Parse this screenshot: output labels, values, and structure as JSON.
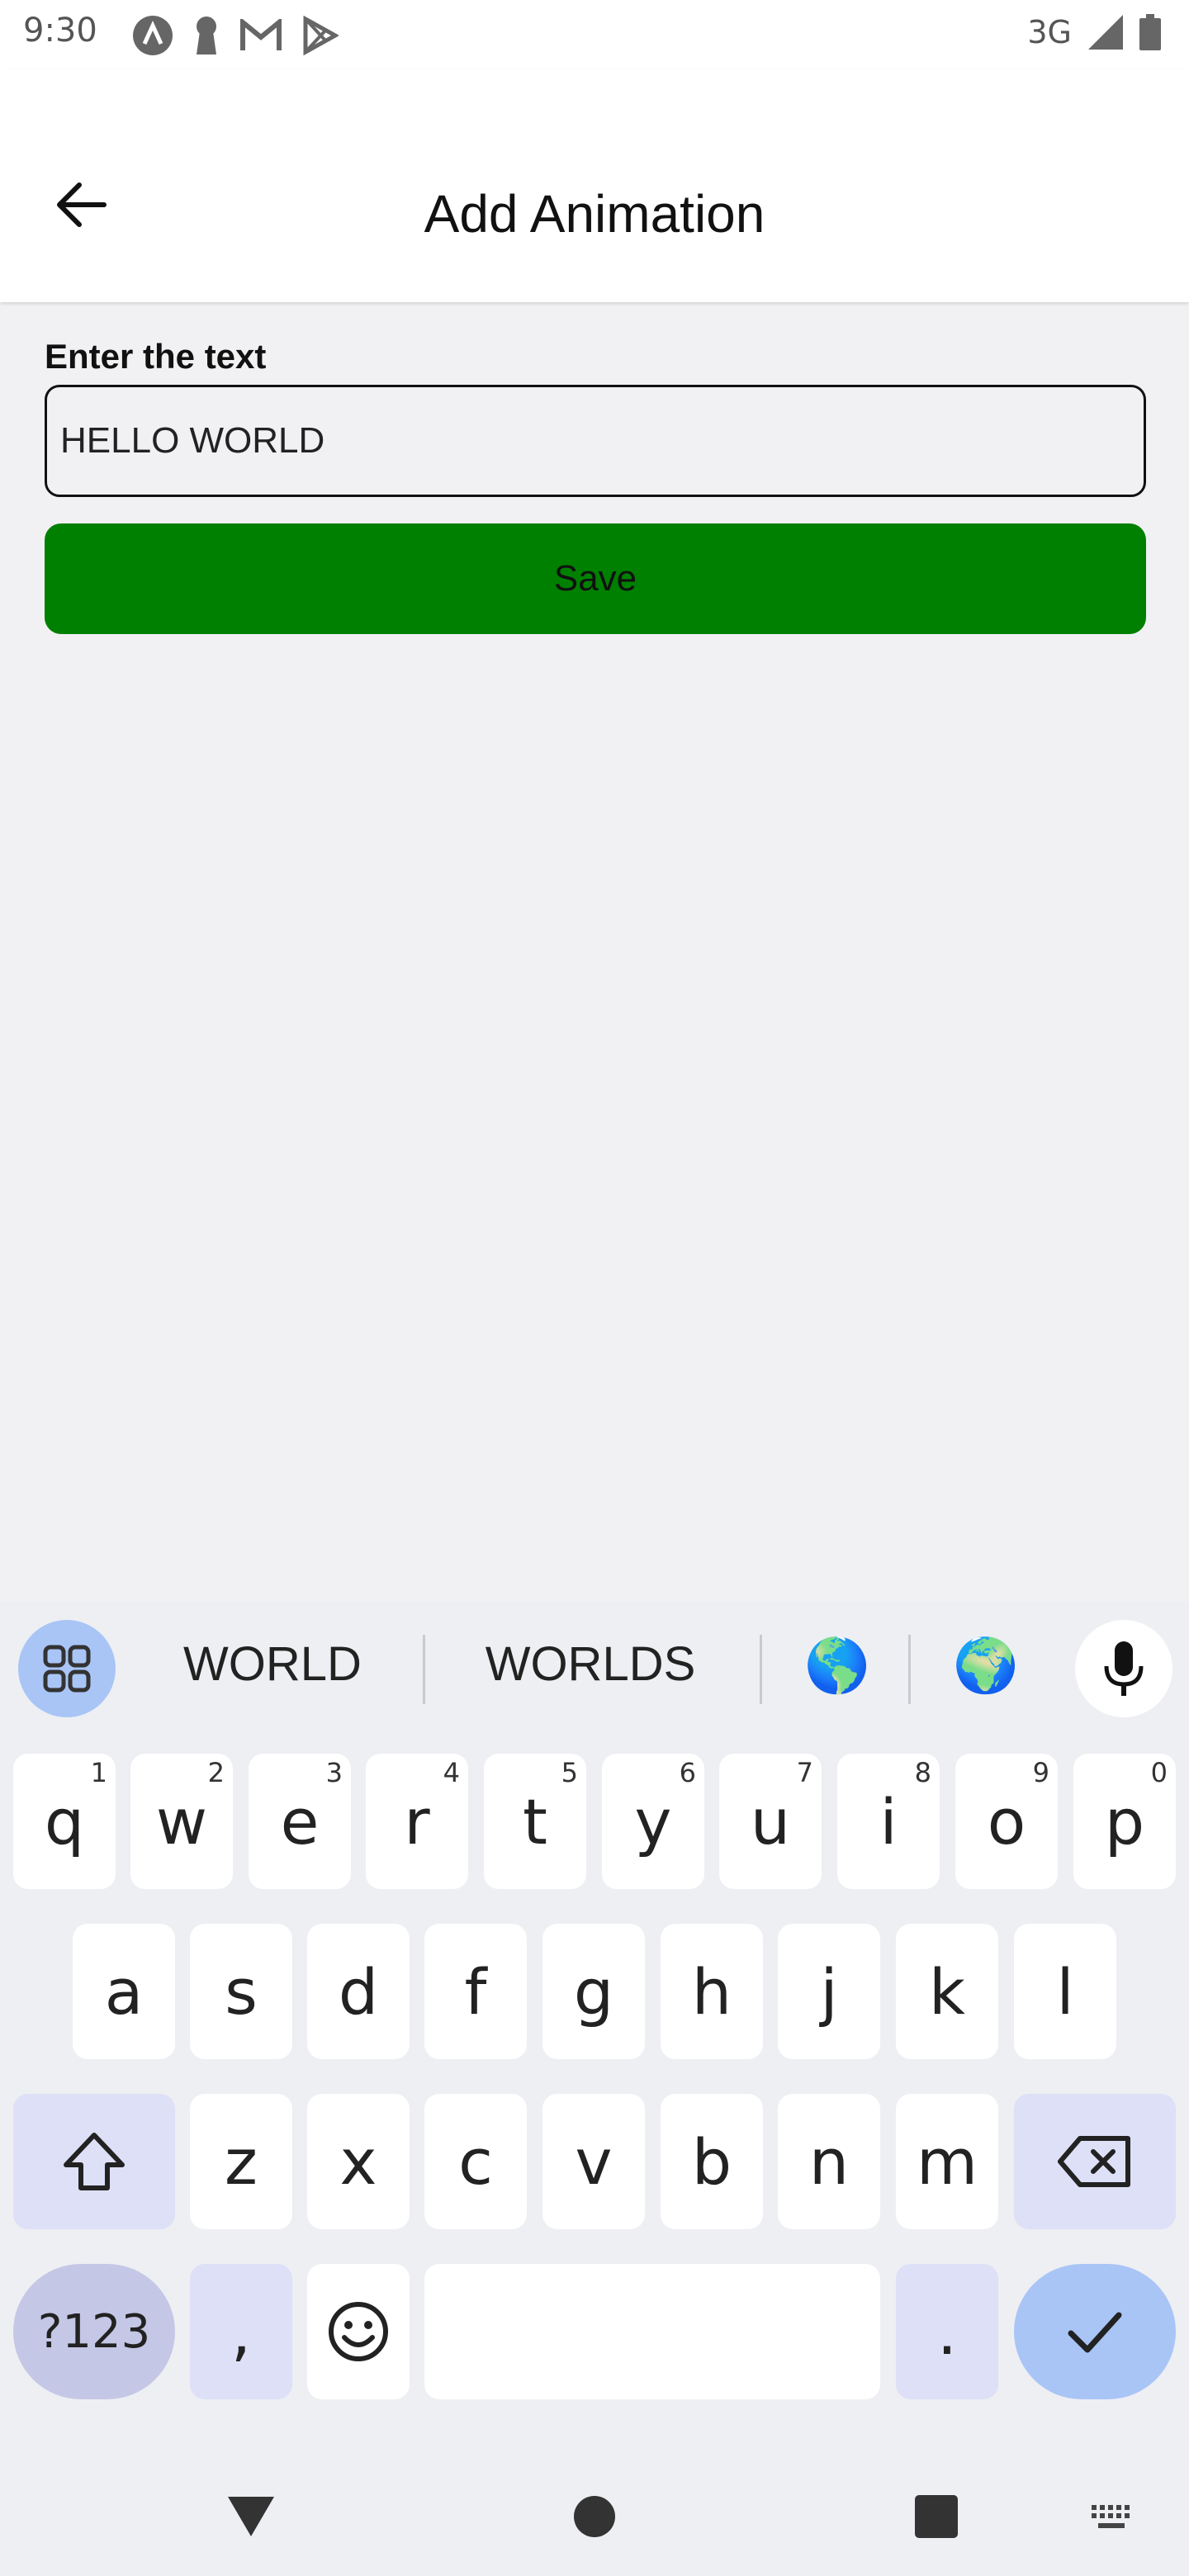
{
  "status_bar": {
    "time": "9:30",
    "network": "3G",
    "left_icons": [
      "app-a-icon",
      "keyhole-icon",
      "gmail-icon",
      "play-store-icon"
    ],
    "right_icons": [
      "signal-icon",
      "battery-icon"
    ]
  },
  "app_bar": {
    "title": "Add Animation",
    "back_icon": "arrow-back-icon"
  },
  "form": {
    "label": "Enter the text",
    "input_value": "HELLO WORLD",
    "save_label": "Save",
    "save_color": "#008000"
  },
  "keyboard": {
    "suggestions": [
      "WORLD",
      "WORLDS"
    ],
    "emoji_suggestions": [
      "🌎",
      "🌍"
    ],
    "row1": [
      {
        "key": "q",
        "hint": "1"
      },
      {
        "key": "w",
        "hint": "2"
      },
      {
        "key": "e",
        "hint": "3"
      },
      {
        "key": "r",
        "hint": "4"
      },
      {
        "key": "t",
        "hint": "5"
      },
      {
        "key": "y",
        "hint": "6"
      },
      {
        "key": "u",
        "hint": "7"
      },
      {
        "key": "i",
        "hint": "8"
      },
      {
        "key": "o",
        "hint": "9"
      },
      {
        "key": "p",
        "hint": "0"
      }
    ],
    "row2": [
      "a",
      "s",
      "d",
      "f",
      "g",
      "h",
      "j",
      "k",
      "l"
    ],
    "row3": [
      "z",
      "x",
      "c",
      "v",
      "b",
      "n",
      "m"
    ],
    "symbols_label": "?123",
    "comma": ",",
    "period": ".",
    "accent_color": "#a9c5f6"
  },
  "nav_bar": {
    "icons": [
      "back-triangle-icon",
      "home-circle-icon",
      "recents-square-icon",
      "keyboard-switch-icon"
    ]
  }
}
